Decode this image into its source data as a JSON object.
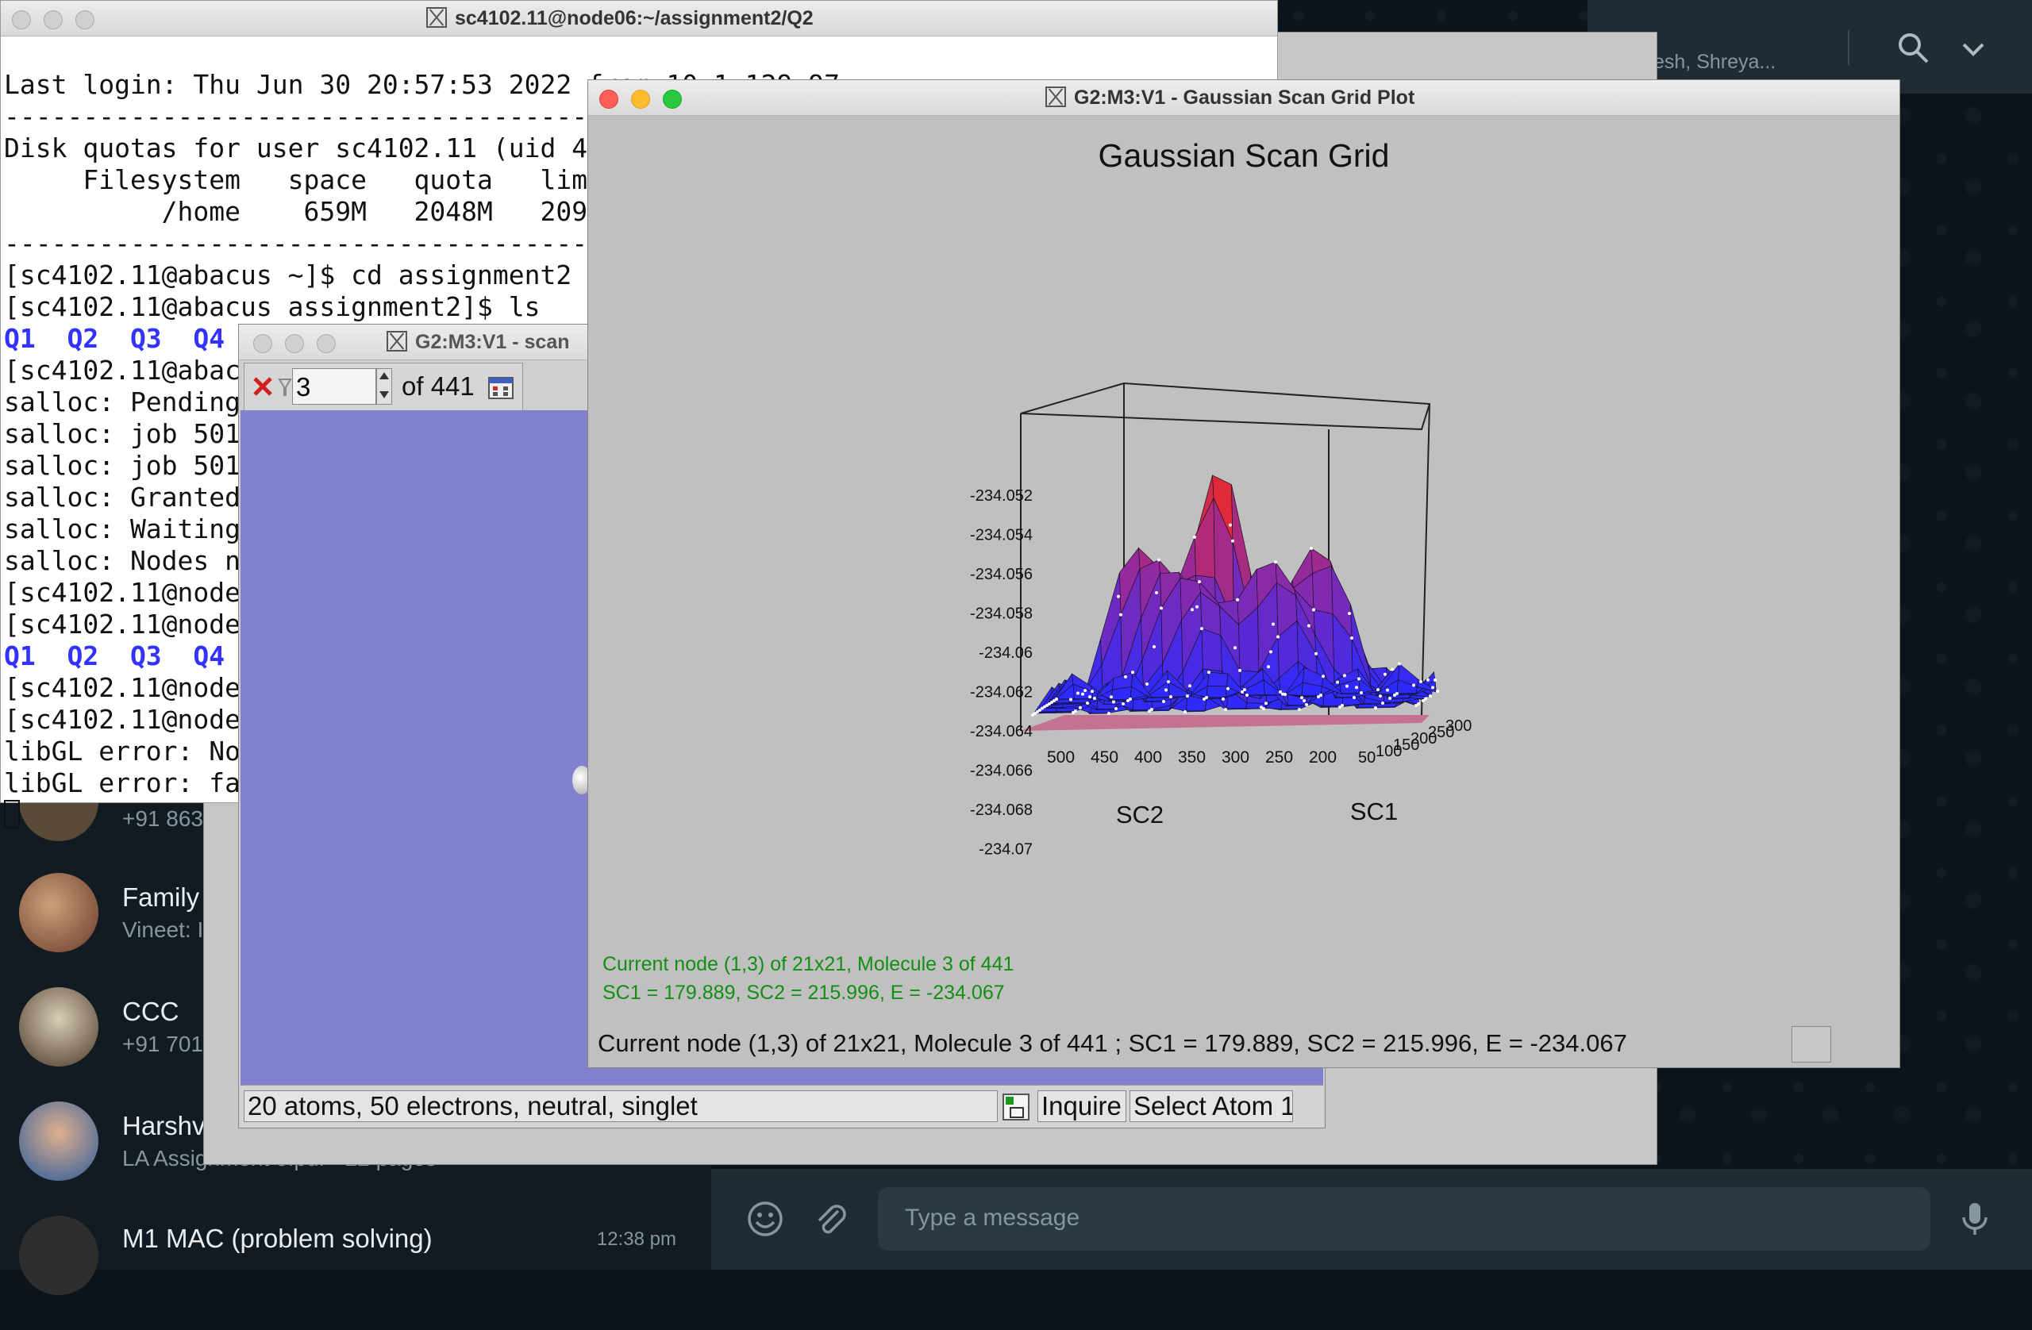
{
  "whatsapp": {
    "header_names": "esh, Shreya...",
    "chats": [
      {
        "name": "",
        "subtitle": "+91 863",
        "time": ""
      },
      {
        "name": "Family",
        "subtitle": "Vineet: I",
        "time": ""
      },
      {
        "name": "CCC",
        "subtitle": "+91 701",
        "time": ""
      },
      {
        "name": "Harshv",
        "subtitle": "LA Assignment 3.pdf • 22 pages",
        "time": ""
      },
      {
        "name": "M1 MAC (problem solving)",
        "subtitle": "",
        "time": "12:38 pm"
      }
    ],
    "compose_placeholder": "Type a message"
  },
  "terminal": {
    "title": "sc4102.11@node06:~/assignment2/Q2",
    "lines": [
      "Last login: Thu Jun 30 20:57:53 2022 from 10.1.129.97",
      "------------------------------------------------------------",
      "Disk quotas for user sc4102.11 (uid 4",
      "     Filesystem   space   quota   lim",
      "          /home    659M   2048M   209",
      "------------------------------------------------------------",
      "[sc4102.11@abacus ~]$ cd assignment2",
      "[sc4102.11@abacus assignment2]$ ls",
      "Q1  Q2  Q3  Q4",
      "[sc4102.11@abac",
      "salloc: Pending",
      "salloc: job 501",
      "salloc: job 501",
      "salloc: Granted",
      "salloc: Waiting",
      "salloc: Nodes n",
      "[sc4102.11@node",
      "[sc4102.11@node",
      "Q1  Q2  Q3  Q4",
      "[sc4102.11@node",
      "[sc4102.11@node",
      "libGL error: No",
      "libGL error: fa"
    ]
  },
  "scan_window": {
    "title": "G2:M3:V1 - scan",
    "molecule_index": "3",
    "of_total": "of 441",
    "status_text": "20 atoms, 50 electrons, neutral, singlet",
    "inquire_label": "Inquire",
    "select_label": "Select Atom 1"
  },
  "plot_window": {
    "title": "G2:M3:V1 - Gaussian Scan Grid Plot",
    "info_line1": "Current node (1,3) of 21x21, Molecule 3 of 441",
    "info_line2": "SC1 = 179.889, SC2 = 215.996, E = -234.067",
    "status": "Current node (1,3) of 21x21, Molecule 3 of 441 ; SC1 = 179.889, SC2 = 215.996, E = -234.067"
  },
  "chart_data": {
    "type": "surface",
    "title": "Gaussian Scan Grid",
    "xlabel": "SC2",
    "ylabel": "SC1",
    "x_ticks": [
      "500",
      "450",
      "400",
      "350",
      "300",
      "250",
      "200"
    ],
    "y_ticks": [
      "50",
      "100",
      "150",
      "200",
      "250",
      "300"
    ],
    "z_ticks": [
      "-234.052",
      "-234.054",
      "-234.056",
      "-234.058",
      "-234.06",
      "-234.062",
      "-234.064",
      "-234.066",
      "-234.068",
      "-234.07"
    ],
    "z_range": [
      -234.07,
      -234.052
    ],
    "grid": "21x21",
    "colors": {
      "low": "#2a2aff",
      "mid": "#8a2aa8",
      "high": "#ff2a10"
    }
  }
}
